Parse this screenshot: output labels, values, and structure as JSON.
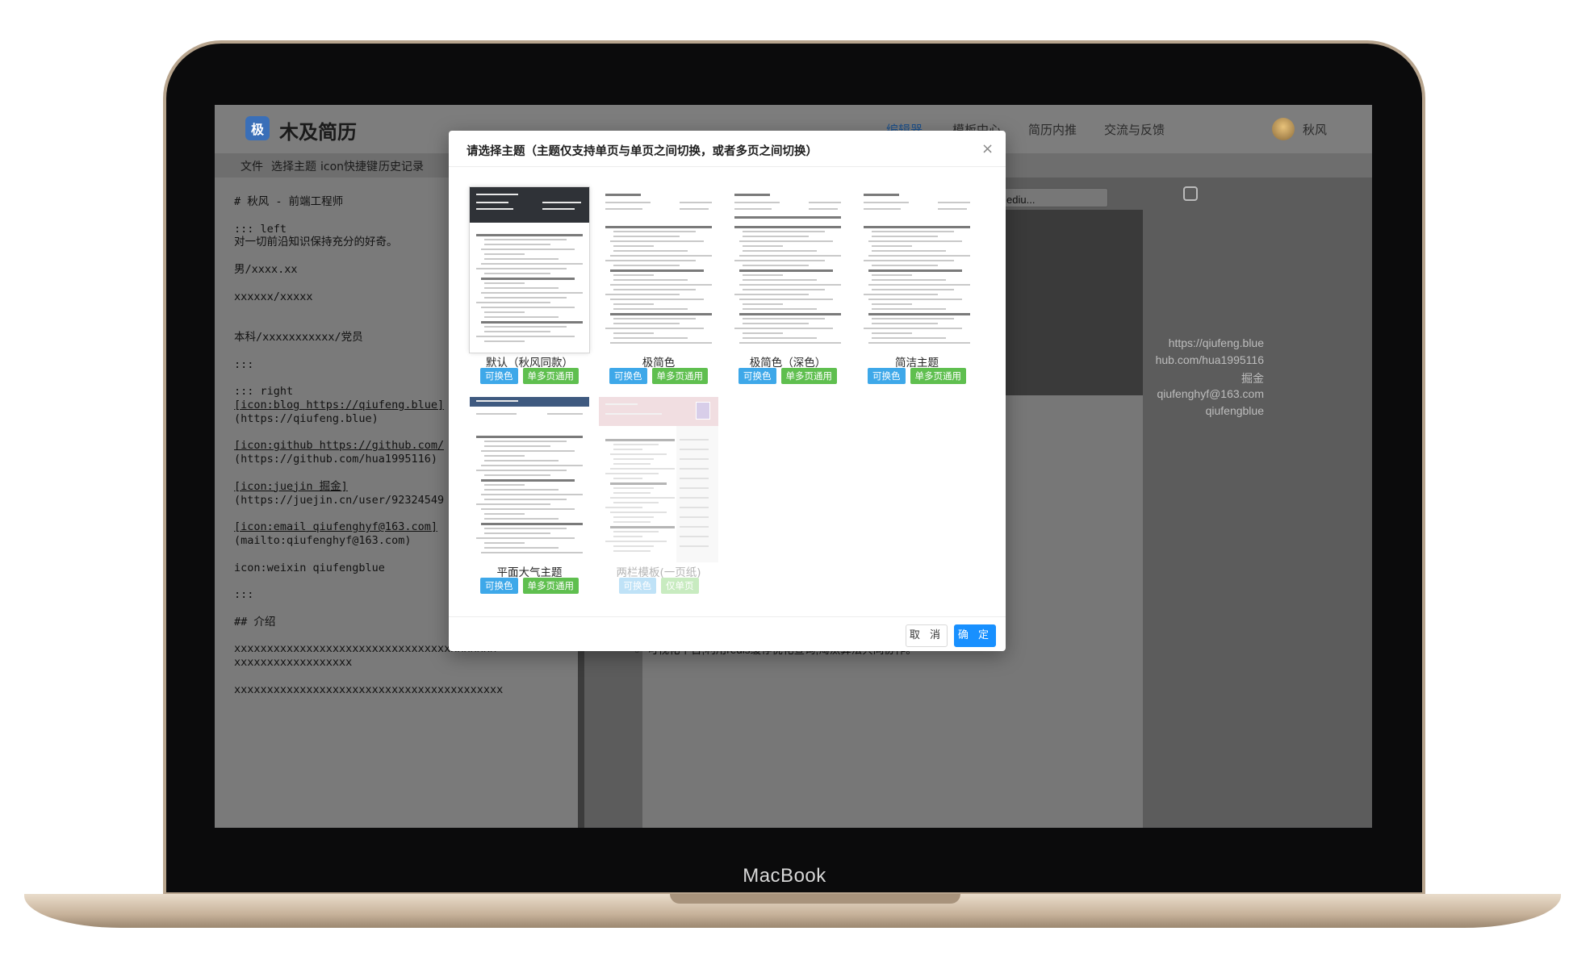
{
  "device_label": "MacBook",
  "app": {
    "logo_char": "极",
    "title": "木及简历",
    "nav": [
      {
        "label": "编辑器",
        "active": true
      },
      {
        "label": "模板中心",
        "active": false
      },
      {
        "label": "简历内推",
        "active": false
      },
      {
        "label": "交流与反馈",
        "active": false
      }
    ],
    "user_name": "秋风"
  },
  "menubar": [
    "文件",
    "选择主题",
    "icon快捷键",
    "历史记录"
  ],
  "editor_lines": [
    "# 秋风 - 前端工程师",
    "",
    "::: left",
    "对一切前沿知识保持充分的好奇。",
    "",
    "男/xxxx.xx",
    "",
    "xxxxxx/xxxxx",
    "",
    "",
    "本科/xxxxxxxxxxx/党员",
    "",
    ":::",
    "",
    "::: right",
    "[icon:blog https://qiufeng.blue]",
    "(https://qiufeng.blue)",
    "",
    "[icon:github https://github.com/",
    "(https://github.com/hua1995116)",
    "",
    "[icon:juejin 掘金]",
    "(https://juejin.cn/user/92324549",
    "",
    "[icon:email qiufenghyf@163.com]",
    "(mailto:qiufenghyf@163.com)",
    "",
    "icon:weixin qiufengblue",
    "",
    ":::",
    "",
    "## 介绍",
    "",
    "xxxxxxxxxxxxxxxxxxxxxxxxxxxxxxxxxxxxxxxx",
    "xxxxxxxxxxxxxxxxxx",
    "",
    "xxxxxxxxxxxxxxxxxxxxxxxxxxxxxxxxxxxxxxxxx"
  ],
  "preview": {
    "font_select": "果方正_Mediu...",
    "links": [
      "https://qiufeng.blue",
      "hub.com/hua1995116",
      "掘金",
      "qiufenghyf@163.com",
      "qiufengblue"
    ],
    "bottom_text": "可视化平台,利用redis缓存优化查询,淘汰算法共同协作。"
  },
  "modal": {
    "title": "请选择主题（主题仅支持单页与单页之间切换，或者多页之间切换）",
    "close_icon": "×",
    "cancel_label": "取 消",
    "ok_label": "确 定",
    "themes": [
      {
        "name": "默认（秋风同款）",
        "tags": [
          "可换色",
          "单多页通用"
        ],
        "style": "dark",
        "selected": true,
        "disabled": false
      },
      {
        "name": "极简色",
        "tags": [
          "可换色",
          "单多页通用"
        ],
        "style": "plain",
        "selected": false,
        "disabled": false
      },
      {
        "name": "极简色（深色）",
        "tags": [
          "可换色",
          "单多页通用"
        ],
        "style": "plain-dark",
        "selected": false,
        "disabled": false
      },
      {
        "name": "简洁主题",
        "tags": [
          "可换色",
          "单多页通用"
        ],
        "style": "clean",
        "selected": false,
        "disabled": false
      },
      {
        "name": "平面大气主题",
        "tags": [
          "可换色",
          "单多页通用"
        ],
        "style": "flat",
        "selected": false,
        "disabled": false
      },
      {
        "name": "两栏模板(一页纸)",
        "tags": [
          "可换色",
          "仅单页"
        ],
        "style": "two-col",
        "selected": false,
        "disabled": true
      }
    ],
    "thumb_heading": "秋风 - 前端工程师"
  }
}
